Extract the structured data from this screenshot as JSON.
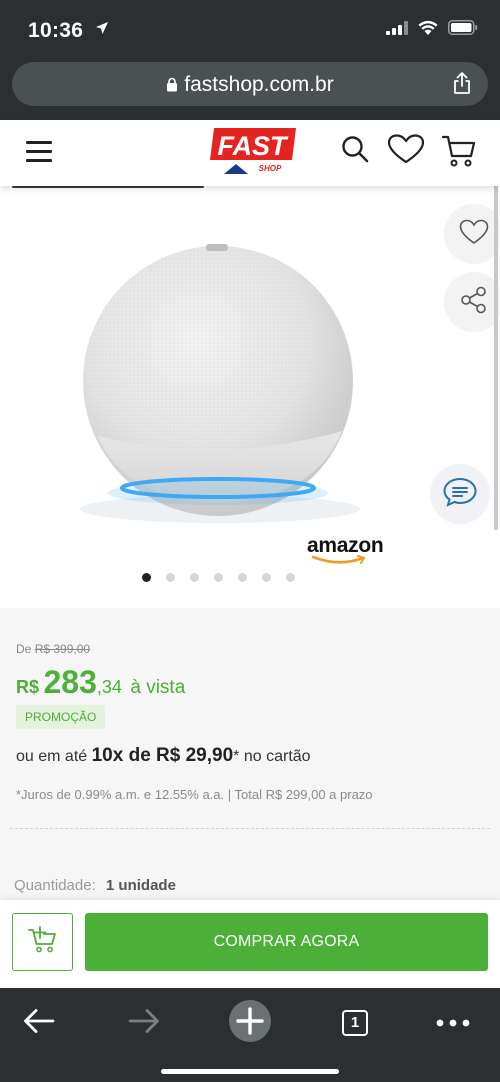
{
  "status_bar": {
    "time": "10:36",
    "icons": [
      "location-arrow-icon",
      "signal-icon",
      "wifi-icon",
      "battery-icon"
    ]
  },
  "browser": {
    "url": "fastshop.com.br",
    "icons": [
      "lock-icon",
      "share-icon"
    ]
  },
  "header": {
    "logo_main": "FAST",
    "logo_sub": "SHOP",
    "icons": [
      "menu-icon",
      "search-icon",
      "heart-icon",
      "cart-icon"
    ]
  },
  "product": {
    "brand_logo": "amazon",
    "gallery_total": 7,
    "gallery_active_index": 0,
    "side_icons": [
      "heart-icon",
      "share-icon",
      "chat-icon"
    ]
  },
  "price": {
    "old_label": "De",
    "old_value": "R$ 399,00",
    "currency": "R$",
    "integer": "283",
    "cents": ",34",
    "cash_label": "à vista",
    "promo_badge": "PROMOÇÃO",
    "installment_prefix": "ou em até",
    "installment_value": "10x de R$ 29,90",
    "installment_asterisk": "*",
    "installment_suffix": "no cartão",
    "interest_note": "*Juros de 0.99% a.m. e 12.55% a.a. | Total R$ 299,00 a prazo"
  },
  "quantity": {
    "label": "Quantidade:",
    "value": "1 unidade"
  },
  "buy_bar": {
    "buy_label": "COMPRAR AGORA",
    "add_cart_icon": "cart-add-icon"
  },
  "toolbar": {
    "tabs_count": "1",
    "icons": [
      "back-icon",
      "forward-icon",
      "new-tab-icon",
      "tabs-icon",
      "more-icon"
    ]
  },
  "colors": {
    "accent_green": "#4caf37",
    "browser_chrome": "#2b2f31",
    "logo_red": "#e52421",
    "logo_blue": "#1b3a8b",
    "echo_ring_blue": "#3fa9f5"
  }
}
